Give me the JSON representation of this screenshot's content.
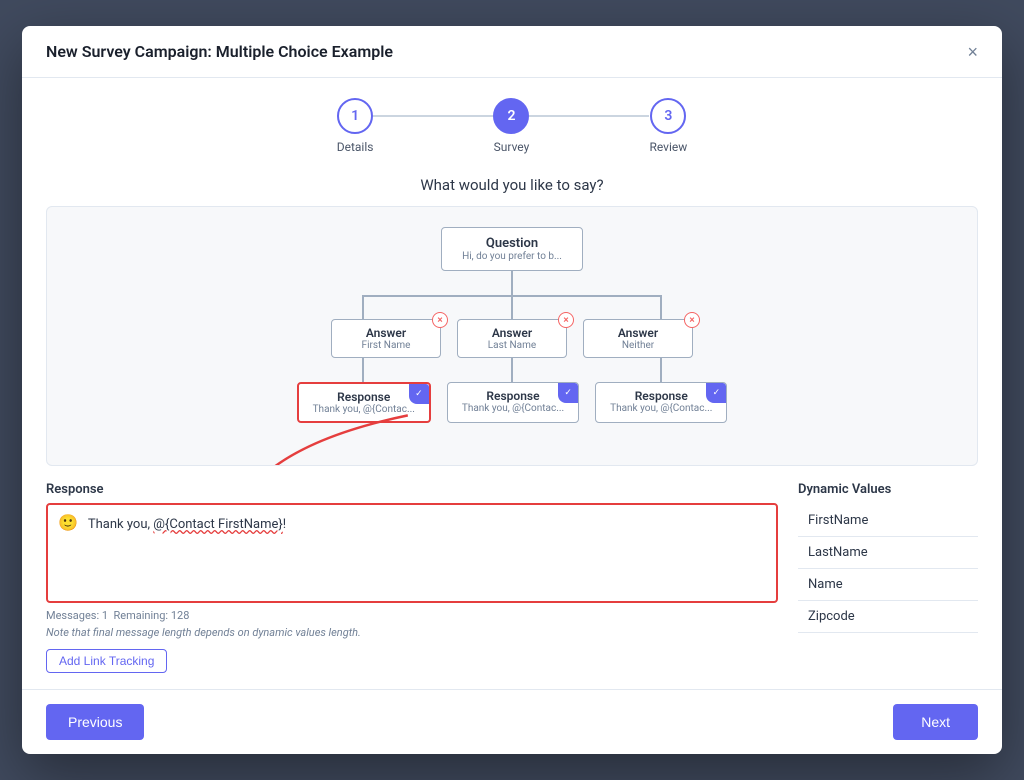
{
  "modal": {
    "title": "New Survey Campaign: Multiple Choice Example",
    "close_label": "×"
  },
  "stepper": {
    "steps": [
      {
        "number": "1",
        "label": "Details",
        "state": "inactive"
      },
      {
        "number": "2",
        "label": "Survey",
        "state": "active"
      },
      {
        "number": "3",
        "label": "Review",
        "state": "inactive"
      }
    ]
  },
  "section_title": "What would you like to say?",
  "flow": {
    "question_label": "Question",
    "question_sub": "Hi, do you prefer to b...",
    "answers": [
      {
        "label": "Answer",
        "sub": "First Name"
      },
      {
        "label": "Answer",
        "sub": "Last Name"
      },
      {
        "label": "Answer",
        "sub": "Neither"
      }
    ],
    "responses": [
      {
        "label": "Response",
        "sub": "Thank you, @{Contac...",
        "selected": true
      },
      {
        "label": "Response",
        "sub": "Thank you, @{Contac...",
        "selected": false
      },
      {
        "label": "Response",
        "sub": "Thank you, @{Contac...",
        "selected": false
      }
    ]
  },
  "response_section": {
    "label": "Response",
    "content_prefix": "Thank you, ",
    "dynamic_part": "@{Contact FirstName}",
    "content_suffix": "!",
    "messages_label": "Messages: 1",
    "remaining_label": "Remaining: 128",
    "note": "Note that final message length depends on dynamic values length.",
    "add_link_label": "Add Link Tracking"
  },
  "dynamic_values": {
    "title": "Dynamic Values",
    "items": [
      "FirstName",
      "LastName",
      "Name",
      "Zipcode"
    ]
  },
  "footer": {
    "previous_label": "Previous",
    "next_label": "Next"
  }
}
